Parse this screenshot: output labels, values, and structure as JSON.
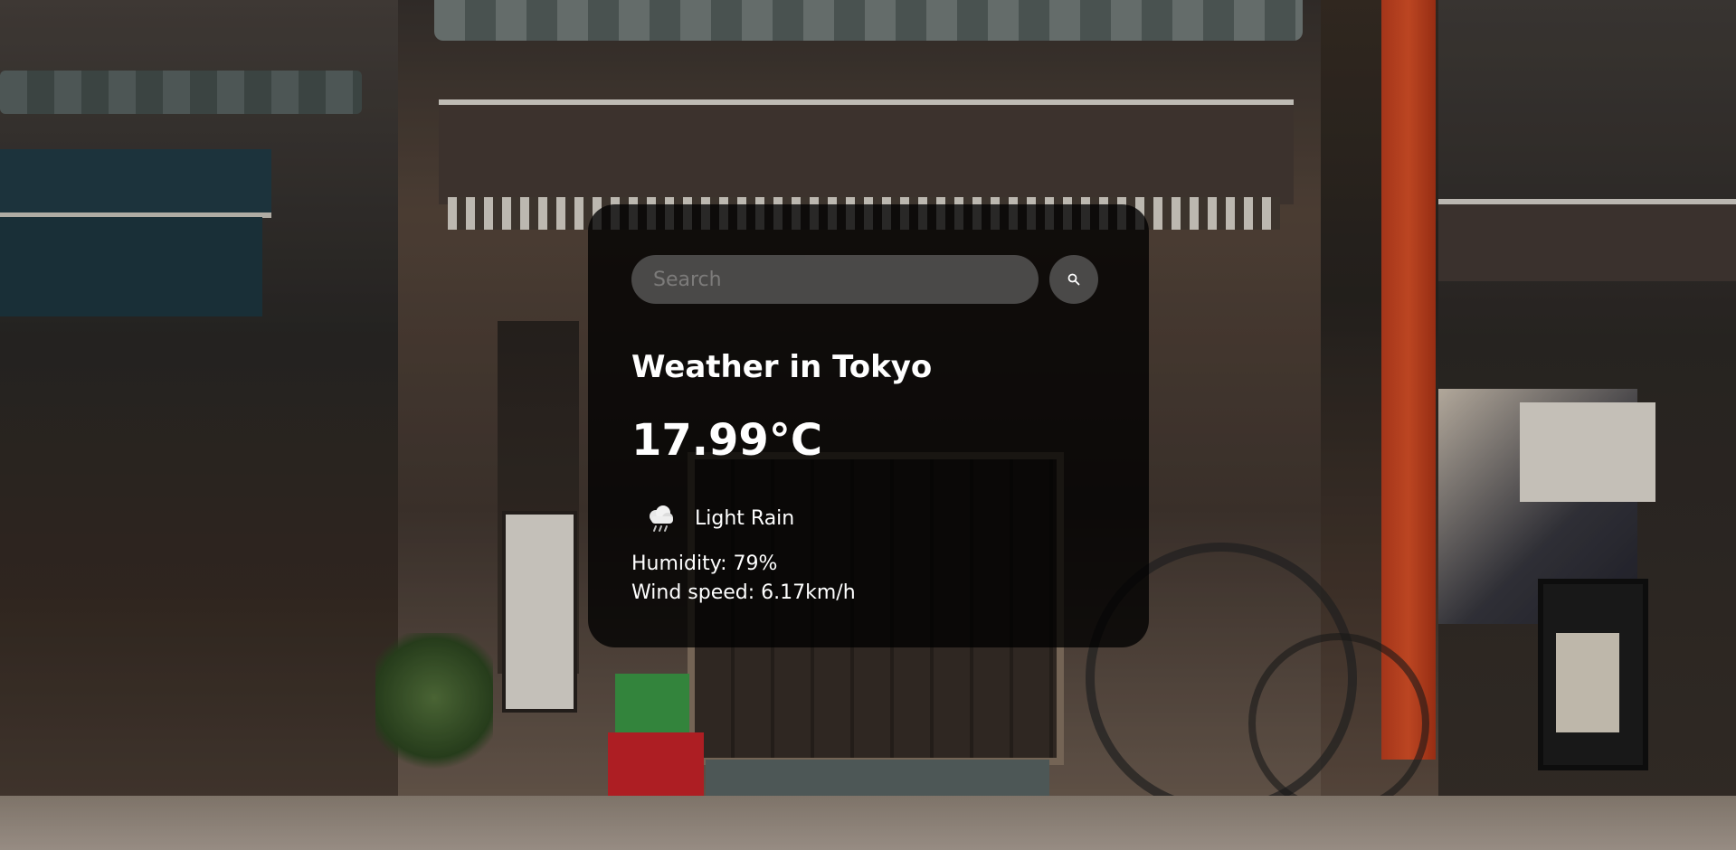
{
  "search": {
    "placeholder": "Search",
    "button_icon": "search-icon"
  },
  "weather": {
    "title": "Weather in Tokyo",
    "temperature": "17.99°C",
    "description": "Light Rain",
    "icon": "rain-cloud-icon",
    "humidity": "Humidity: 79%",
    "wind": "Wind speed: 6.17km/h"
  },
  "colors": {
    "card_background": "rgba(0,0,0,0.78)",
    "text": "#ffffff",
    "input_background": "#7b7b7b"
  }
}
